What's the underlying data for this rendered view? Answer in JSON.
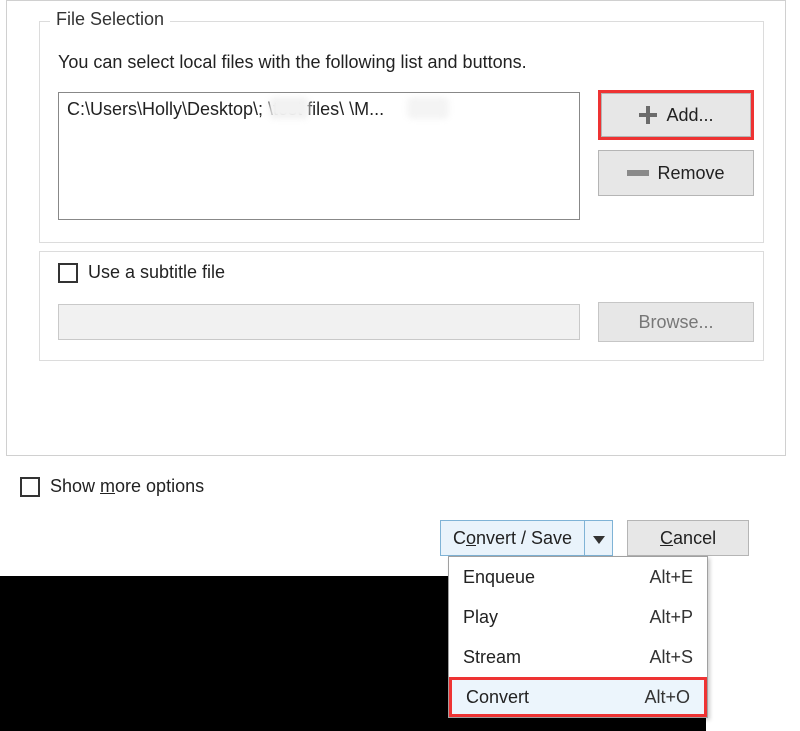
{
  "file_selection": {
    "legend": "File Selection",
    "description": "You can select local files with the following list and buttons.",
    "path_display": "C:\\Users\\Holly\\Desktop\\;      \\test files\\        \\M...",
    "add_label": "Add...",
    "remove_label": "Remove"
  },
  "subtitle": {
    "checkbox_label": "Use a subtitle file",
    "browse_label": "Browse..."
  },
  "show_more": {
    "label_prefix": "Show ",
    "label_underline": "m",
    "label_suffix": "ore options"
  },
  "actions": {
    "convert_save_prefix": "C",
    "convert_save_underline": "o",
    "convert_save_suffix": "nvert / Save",
    "cancel_underline": "C",
    "cancel_suffix": "ancel"
  },
  "menu": {
    "items": [
      {
        "label": "Enqueue",
        "shortcut": "Alt+E"
      },
      {
        "label": "Play",
        "shortcut": "Alt+P"
      },
      {
        "label": "Stream",
        "shortcut": "Alt+S"
      },
      {
        "label": "Convert",
        "shortcut": "Alt+O"
      }
    ]
  }
}
